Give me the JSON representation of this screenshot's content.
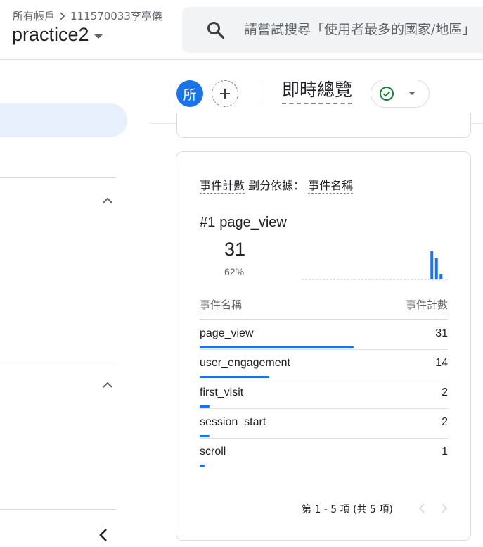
{
  "header": {
    "breadcrumb_root": "所有帳戶",
    "breadcrumb_account": "111570033李亭儀",
    "property_name": "practice2",
    "search_placeholder": "請嘗試搜尋「使用者最多的國家/地區」"
  },
  "toolbar": {
    "avatar_letter": "所",
    "title": "即時總覽"
  },
  "card": {
    "metric_label": "事件計數",
    "split_label": "劃分依據：",
    "dimension_label": "事件名稱",
    "top_rank": "#1",
    "top_name": "page_view",
    "top_value": "31",
    "top_percent": "62%",
    "col_name": "事件名稱",
    "col_count": "事件計數",
    "rows": [
      {
        "name": "page_view",
        "count": "31",
        "share": 0.62
      },
      {
        "name": "user_engagement",
        "count": "14",
        "share": 0.28
      },
      {
        "name": "first_visit",
        "count": "2",
        "share": 0.04
      },
      {
        "name": "session_start",
        "count": "2",
        "share": 0.04
      },
      {
        "name": "scroll",
        "count": "1",
        "share": 0.02
      }
    ],
    "pagination": "第 1 - 5 項 (共 5 項)",
    "sparkline": [
      0,
      0,
      0,
      0,
      0,
      0,
      0,
      0,
      0,
      0,
      0,
      0,
      0,
      0,
      0,
      0,
      0,
      0,
      0,
      0,
      0,
      0,
      0,
      0,
      0,
      0,
      0,
      0,
      1,
      0.75,
      0.2,
      0
    ]
  },
  "colors": {
    "accent": "#1a73e8",
    "nav_active_bg": "#e8f0fe",
    "status_ok": "#188038"
  }
}
